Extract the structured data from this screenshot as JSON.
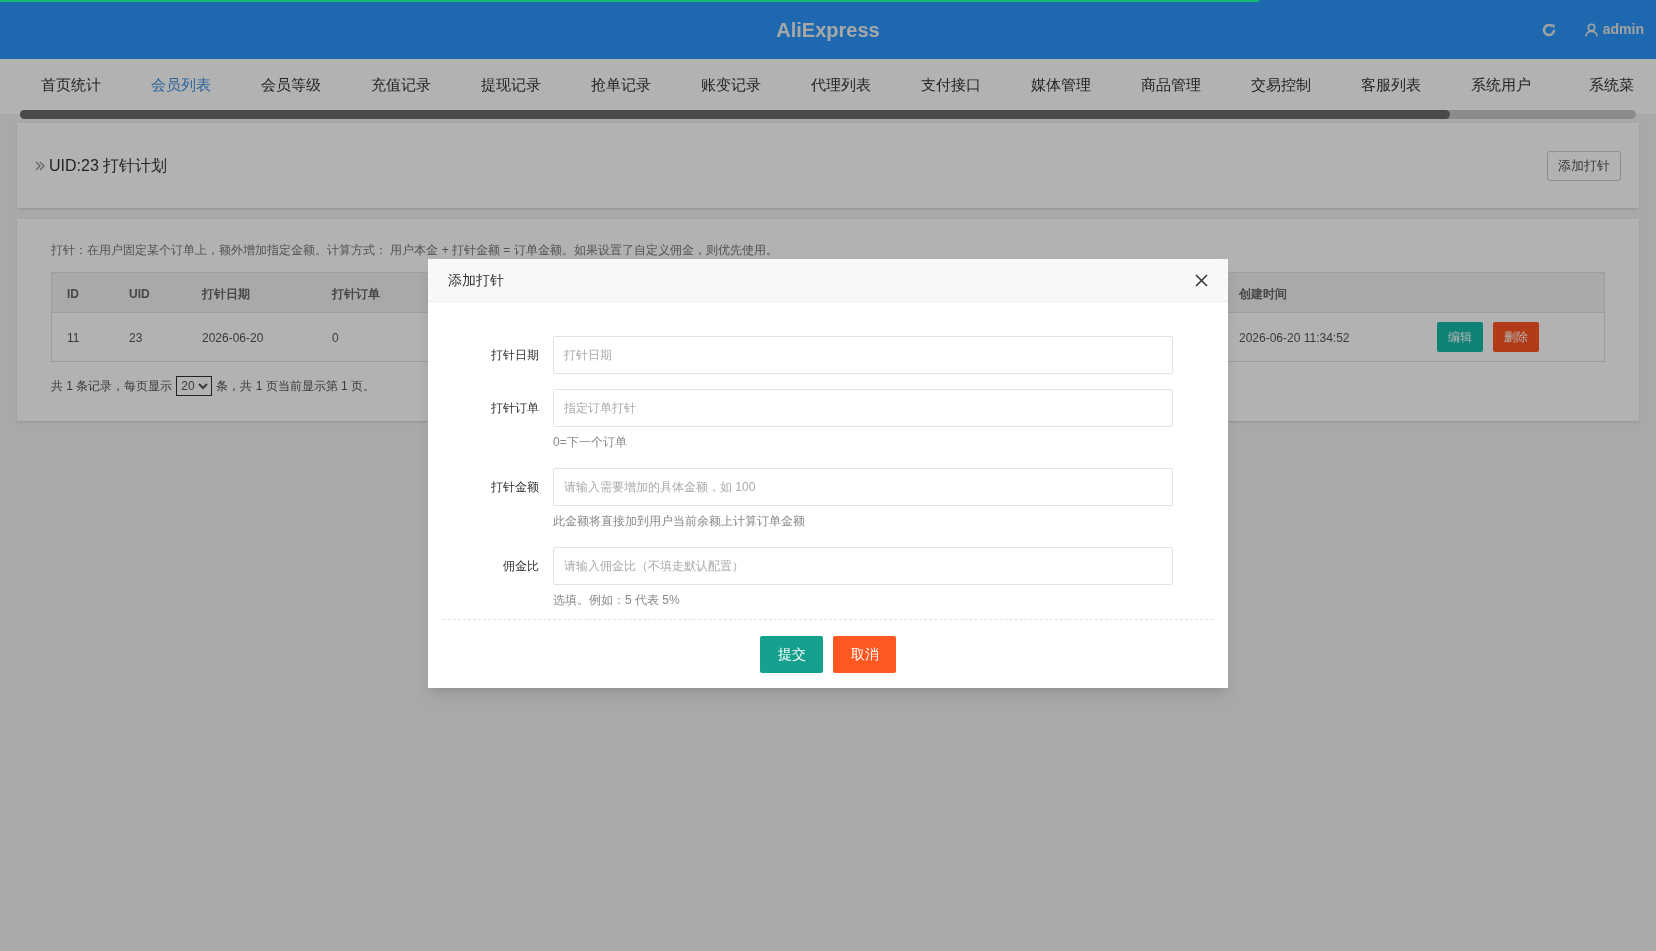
{
  "loading_bar": {
    "level": 0.76
  },
  "header": {
    "title": "AliExpress",
    "user": "admin"
  },
  "nav_tabs": [
    {
      "label": "首页统计",
      "selected": false
    },
    {
      "label": "会员列表",
      "selected": true
    },
    {
      "label": "会员等级",
      "selected": false
    },
    {
      "label": "充值记录",
      "selected": false
    },
    {
      "label": "提现记录",
      "selected": false
    },
    {
      "label": "抢单记录",
      "selected": false
    },
    {
      "label": "账变记录",
      "selected": false
    },
    {
      "label": "代理列表",
      "selected": false
    },
    {
      "label": "支付接口",
      "selected": false
    },
    {
      "label": "媒体管理",
      "selected": false
    },
    {
      "label": "商品管理",
      "selected": false
    },
    {
      "label": "交易控制",
      "selected": false
    },
    {
      "label": "客服列表",
      "selected": false
    },
    {
      "label": "系统用户",
      "selected": false
    },
    {
      "label": "系统菜",
      "selected": false
    }
  ],
  "page_header": {
    "title": "UID:23 打针计划",
    "add_button": "添加打针"
  },
  "note": "打针：在用户固定某个订单上，额外增加指定金额。计算方式： 用户本金 + 打针金额 = 订单金额。如果设置了自定义佣金，则优先使用。",
  "table": {
    "columns": [
      "ID",
      "UID",
      "打针日期",
      "打针订单",
      "创建时间"
    ],
    "rows": [
      {
        "cells": [
          "11",
          "23",
          "2026-06-20",
          "0",
          "2026-06-20 11:34:52"
        ],
        "actions": [
          {
            "kind": "edit",
            "label": "编辑"
          },
          {
            "kind": "delete",
            "label": "删除"
          }
        ]
      }
    ]
  },
  "pagination": {
    "before": "共 1 条记录，每页显示",
    "page_size": "20",
    "after": "条，共 1 页当前显示第 1 页。"
  },
  "modal": {
    "title": "添加打针",
    "fields": [
      {
        "label": "打针日期",
        "placeholder": "打针日期"
      },
      {
        "label": "打针订单",
        "placeholder": "指定订单打针",
        "hint": "0=下一个订单"
      },
      {
        "label": "打针金额",
        "placeholder": "请输入需要增加的具体金额，如 100",
        "hint": "此金额将直接加到用户当前余额上计算订单金额"
      },
      {
        "label": "佣金比",
        "placeholder": "请输入佣金比（不填走默认配置）",
        "hint": "选填。例如：5 代表 5%"
      }
    ],
    "buttons": [
      {
        "kind": "submit",
        "label": "提交"
      },
      {
        "kind": "cancel",
        "label": "取消"
      }
    ]
  }
}
